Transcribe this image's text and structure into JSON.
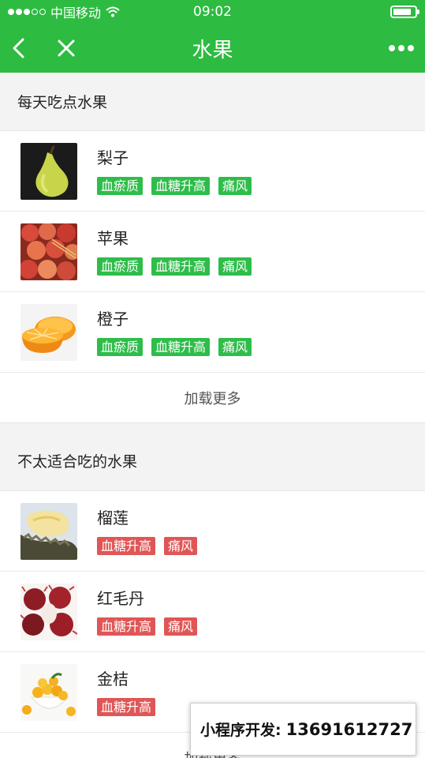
{
  "status_bar": {
    "carrier": "中国移动",
    "time": "09:02",
    "battery_level": 0.85
  },
  "nav": {
    "title": "水果",
    "back_icon": "chevron-left-icon",
    "close_icon": "close-icon",
    "more_icon": "more-dots-icon"
  },
  "colors": {
    "brand": "#2dbb41",
    "good_tag": "#2fbd4a",
    "bad_tag": "#e05656"
  },
  "sections": [
    {
      "title": "每天吃点水果",
      "items": [
        {
          "name": "梨子",
          "image": "pear-image",
          "tags": [
            "血瘀质",
            "血糖升高",
            "痛风"
          ]
        },
        {
          "name": "苹果",
          "image": "apples-image",
          "tags": [
            "血瘀质",
            "血糖升高",
            "痛风"
          ]
        },
        {
          "name": "橙子",
          "image": "orange-image",
          "tags": [
            "血瘀质",
            "血糖升高",
            "痛风"
          ]
        }
      ],
      "load_more": "加载更多"
    },
    {
      "title": "不太适合吃的水果",
      "items": [
        {
          "name": "榴莲",
          "image": "durian-image",
          "tags": [
            "血糖升高",
            "痛风"
          ]
        },
        {
          "name": "红毛丹",
          "image": "rambutan-image",
          "tags": [
            "血糖升高",
            "痛风"
          ]
        },
        {
          "name": "金桔",
          "image": "kumquat-image",
          "tags": [
            "血糖升高"
          ]
        }
      ],
      "load_more": "加载更多"
    }
  ],
  "watermark": {
    "label": "小程序开发:",
    "phone": "13691612727"
  }
}
